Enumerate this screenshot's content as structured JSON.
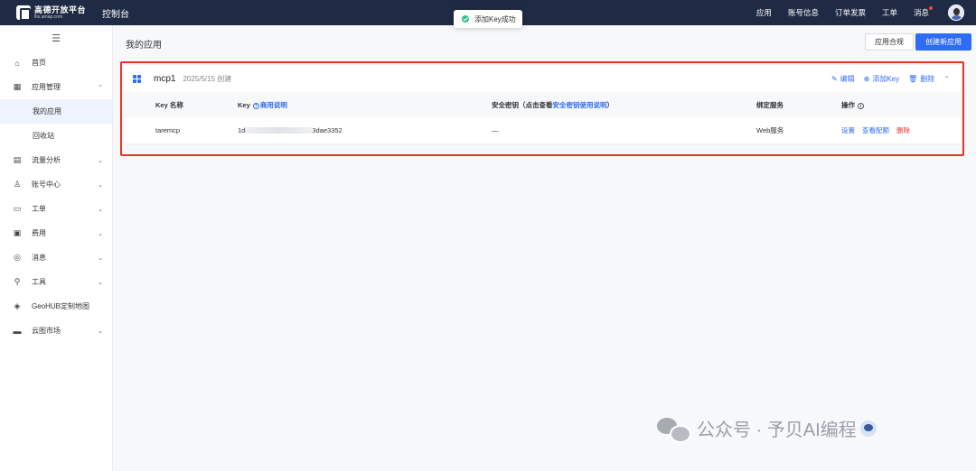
{
  "header": {
    "logo_name": "高德开放平台",
    "logo_sub": "lbs.amap.com",
    "console": "控制台",
    "nav": [
      "应用",
      "账号信息",
      "订单发票",
      "工单",
      "消息"
    ]
  },
  "toast": {
    "message": "添加Key成功"
  },
  "sidebar": {
    "collapse": "☰",
    "items": [
      {
        "label": "首页",
        "icon": "home-icon",
        "glyph": "⌂",
        "chev": ""
      },
      {
        "label": "应用管理",
        "icon": "grid-icon",
        "glyph": "▦",
        "chev": "⌃"
      },
      {
        "label": "我的应用",
        "icon": "",
        "glyph": "",
        "chev": ""
      },
      {
        "label": "回收站",
        "icon": "",
        "glyph": "",
        "chev": ""
      },
      {
        "label": "流量分析",
        "icon": "chart-icon",
        "glyph": "▤",
        "chev": "⌄"
      },
      {
        "label": "账号中心",
        "icon": "user-icon",
        "glyph": "♙",
        "chev": "⌄"
      },
      {
        "label": "工单",
        "icon": "ticket-icon",
        "glyph": "▭",
        "chev": "⌄"
      },
      {
        "label": "费用",
        "icon": "fee-icon",
        "glyph": "▣",
        "chev": "⌄"
      },
      {
        "label": "消息",
        "icon": "message-icon",
        "glyph": "◎",
        "chev": "⌄"
      },
      {
        "label": "工具",
        "icon": "tool-icon",
        "glyph": "⚲",
        "chev": "⌄"
      },
      {
        "label": "GeoHUB定制地图",
        "icon": "layers-icon",
        "glyph": "◈",
        "chev": ""
      },
      {
        "label": "云图市场",
        "icon": "store-icon",
        "glyph": "▬",
        "chev": "⌄"
      }
    ]
  },
  "main": {
    "title": "我的应用",
    "compliance_button": "应用合规",
    "create_button": "创建新应用"
  },
  "app": {
    "name": "mcp1",
    "date": "2025/5/15 创建",
    "actions": {
      "edit": "编辑",
      "add_key": "添加Key",
      "delete": "删除"
    },
    "table": {
      "headers": {
        "key_name": "Key 名称",
        "key": "Key",
        "key_help": "商用说明",
        "secret": "安全密钥（点击查看",
        "secret_link": "安全密钥使用说明",
        "secret_end": "）",
        "service": "绑定服务",
        "ops": "操作"
      },
      "rows": [
        {
          "key_name": "taremcp",
          "key_start": "1d",
          "key_end": "3dae3352",
          "secret": "—",
          "service": "Web服务",
          "ops": {
            "settings": "设置",
            "quota": "查看配额",
            "delete": "删除"
          }
        }
      ]
    }
  },
  "watermark": {
    "text": "公众号 · 予贝AI编程"
  },
  "colors": {
    "primary": "#2f6cf6",
    "danger": "#e8322b",
    "header_bg": "#1f2a44"
  }
}
